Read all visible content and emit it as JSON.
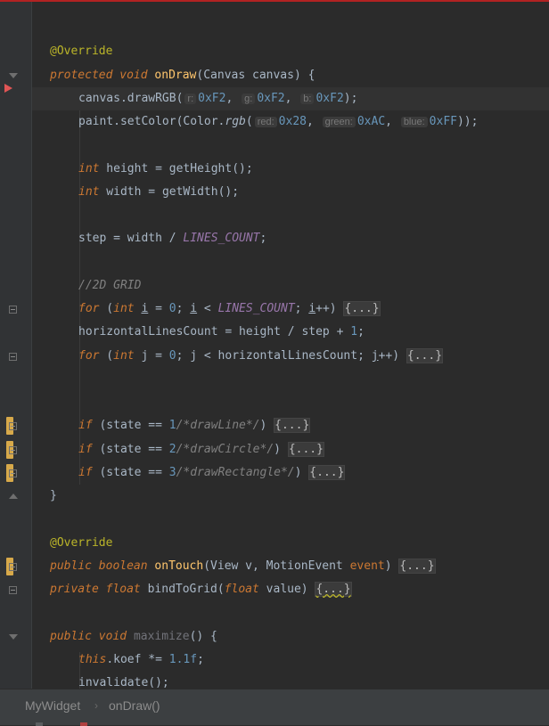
{
  "code": {
    "l1_ann": "@Override",
    "l2_kw1": "protected",
    "l2_kw2": "void",
    "l2_fn": "onDraw",
    "l2_rest": "(Canvas canvas) {",
    "l3_obj": "canvas.",
    "l3_m": "drawRGB",
    "l3_h1": "r:",
    "l3_v1": "0xF2",
    "l3_h2": "g:",
    "l3_v2": "0xF2",
    "l3_h3": "b:",
    "l3_v3": "0xF2",
    "l3_end": ");",
    "l4_obj": "paint.",
    "l4_m": "setColor",
    "l4_cls": "Color.",
    "l4_m2": "rgb",
    "l4_h1": "red:",
    "l4_v1": "0x28",
    "l4_h2": "green:",
    "l4_v2": "0xAC",
    "l4_h3": "blue:",
    "l4_v3": "0xFF",
    "l4_end": "));",
    "l5_kw": "int",
    "l5_rest": " height = ",
    "l5_m": "getHeight",
    "l5_end": "();",
    "l6_kw": "int",
    "l6_rest": " width = ",
    "l6_m": "getWidth",
    "l6_end": "();",
    "l7_a": "step = width / ",
    "l7_const": "LINES_COUNT",
    "l7_end": ";",
    "l8_cmt": "//2D GRID",
    "l9_kw": "for",
    "l9_kw2": "int",
    "l9_i": "i",
    "l9_b": " = ",
    "l9_n": "0",
    "l9_c": "; ",
    "l9_i2": "i",
    "l9_d": " < ",
    "l9_const": "LINES_COUNT",
    "l9_e": "; ",
    "l9_i3": "i",
    "l9_f": "++) ",
    "l9_fold": "{...}",
    "l10_a": "horizontalLinesCount = height / step + ",
    "l10_n": "1",
    "l10_end": ";",
    "l11_kw": "for",
    "l11_kw2": "int",
    "l11_a": " j = ",
    "l11_n": "0",
    "l11_b": "; j < horizontalLinesCount; ",
    "l11_j": "j",
    "l11_c": "++) ",
    "l11_fold": "{...}",
    "l12_kw": "if",
    "l12_a": " (state == ",
    "l12_n": "1",
    "l12_cmt": "/*drawLine*/",
    "l12_b": ") ",
    "l12_fold": "{...}",
    "l13_kw": "if",
    "l13_a": " (state == ",
    "l13_n": "2",
    "l13_cmt": "/*drawCircle*/",
    "l13_b": ") ",
    "l13_fold": "{...}",
    "l14_kw": "if",
    "l14_a": " (state == ",
    "l14_n": "3",
    "l14_cmt": "/*drawRectangle*/",
    "l14_b": ") ",
    "l14_fold": "{...}",
    "l15": "}",
    "l16_ann": "@Override",
    "l17_kw1": "public",
    "l17_kw2": "boolean",
    "l17_fn": "onTouch",
    "l17_a": "(View v, MotionEvent ",
    "l17_p": "event",
    "l17_b": ") ",
    "l17_fold": "{...}",
    "l18_kw1": "private",
    "l18_kw2": "float",
    "l18_fn": "bindToGrid",
    "l18_a": "(",
    "l18_kw3": "float",
    "l18_b": " value) ",
    "l18_fold": "{...}",
    "l19_kw1": "public",
    "l19_kw2": "void",
    "l19_fn": "maximize",
    "l19_rest": "() {",
    "l20_kw": "this",
    "l20_a": ".",
    "l20_f": "koef",
    "l20_b": " *= ",
    "l20_n": "1.1f",
    "l20_end": ";",
    "l21_m": "invalidate",
    "l21_end": "();"
  },
  "breadcrumb": {
    "class_name": "MyWidget",
    "separator": "›",
    "method_name": "onDraw()"
  },
  "colors": {
    "background": "#2b2b2b",
    "keyword": "#cc7832",
    "annotation": "#bbb529",
    "method": "#ffc66d",
    "number": "#6897bb",
    "constant": "#9876aa",
    "comment": "#808080",
    "change_marker": "#d7a94a"
  }
}
